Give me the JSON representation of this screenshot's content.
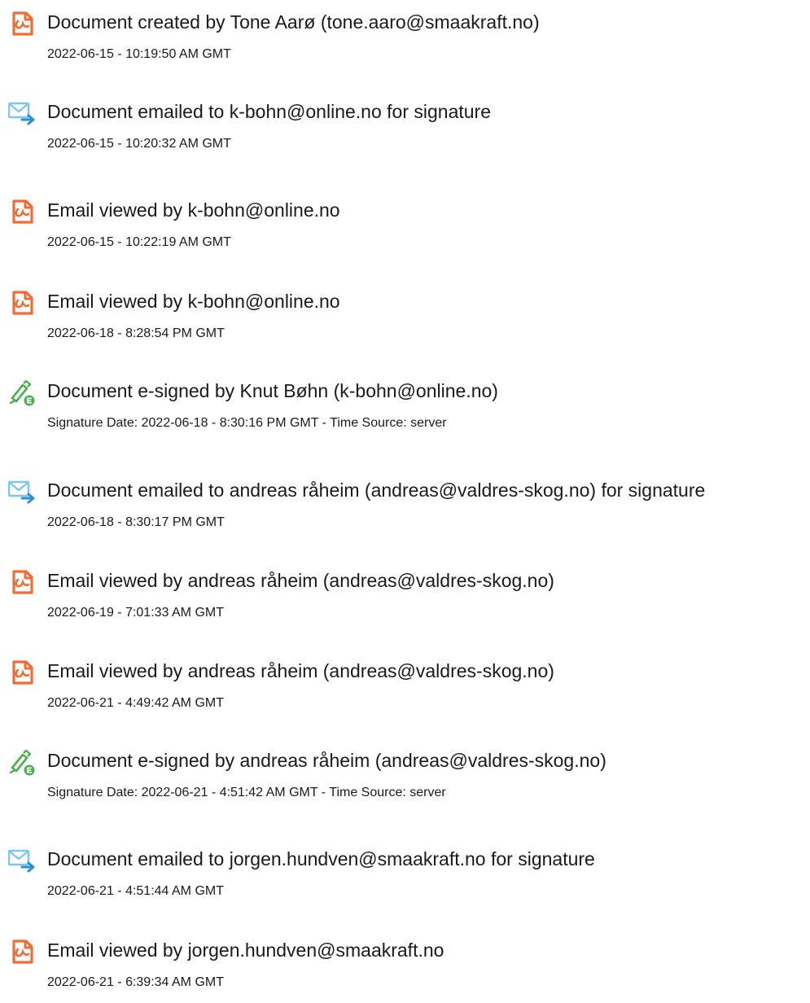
{
  "colors": {
    "doc_icon": "#f36b34",
    "email_icon_body": "#7fc6ea",
    "email_icon_arrow": "#2f8fd6",
    "sign_icon": "#4caf50",
    "text": "#1a1a1a"
  },
  "events": [
    {
      "icon": "document-icon",
      "title": "Document created by Tone Aarø (tone.aaro@smaakraft.no)",
      "timestamp": "2022-06-15 - 10:19:50 AM GMT"
    },
    {
      "icon": "email-sent-icon",
      "title": "Document emailed to k-bohn@online.no for signature",
      "timestamp": "2022-06-15 - 10:20:32 AM GMT"
    },
    {
      "icon": "document-icon",
      "title": "Email viewed by k-bohn@online.no",
      "timestamp": "2022-06-15 - 10:22:19 AM GMT"
    },
    {
      "icon": "document-icon",
      "title": "Email viewed by k-bohn@online.no",
      "timestamp": "2022-06-18 - 8:28:54 PM GMT"
    },
    {
      "icon": "e-sign-icon",
      "title": "Document e-signed by Knut Bøhn (k-bohn@online.no)",
      "timestamp": "Signature Date: 2022-06-18 - 8:30:16 PM GMT - Time Source: server"
    },
    {
      "icon": "email-sent-icon",
      "title": "Document emailed to andreas råheim (andreas@valdres-skog.no) for signature",
      "timestamp": "2022-06-18 - 8:30:17 PM GMT"
    },
    {
      "icon": "document-icon",
      "title": "Email viewed by andreas råheim (andreas@valdres-skog.no)",
      "timestamp": "2022-06-19 - 7:01:33 AM GMT"
    },
    {
      "icon": "document-icon",
      "title": "Email viewed by andreas råheim (andreas@valdres-skog.no)",
      "timestamp": "2022-06-21 - 4:49:42 AM GMT"
    },
    {
      "icon": "e-sign-icon",
      "title": "Document e-signed by andreas råheim (andreas@valdres-skog.no)",
      "timestamp": "Signature Date: 2022-06-21 - 4:51:42 AM GMT - Time Source: server"
    },
    {
      "icon": "email-sent-icon",
      "title": "Document emailed to jorgen.hundven@smaakraft.no for signature",
      "timestamp": "2022-06-21 - 4:51:44 AM GMT"
    },
    {
      "icon": "document-icon",
      "title": "Email viewed by jorgen.hundven@smaakraft.no",
      "timestamp": "2022-06-21 - 6:39:34 AM GMT"
    }
  ]
}
